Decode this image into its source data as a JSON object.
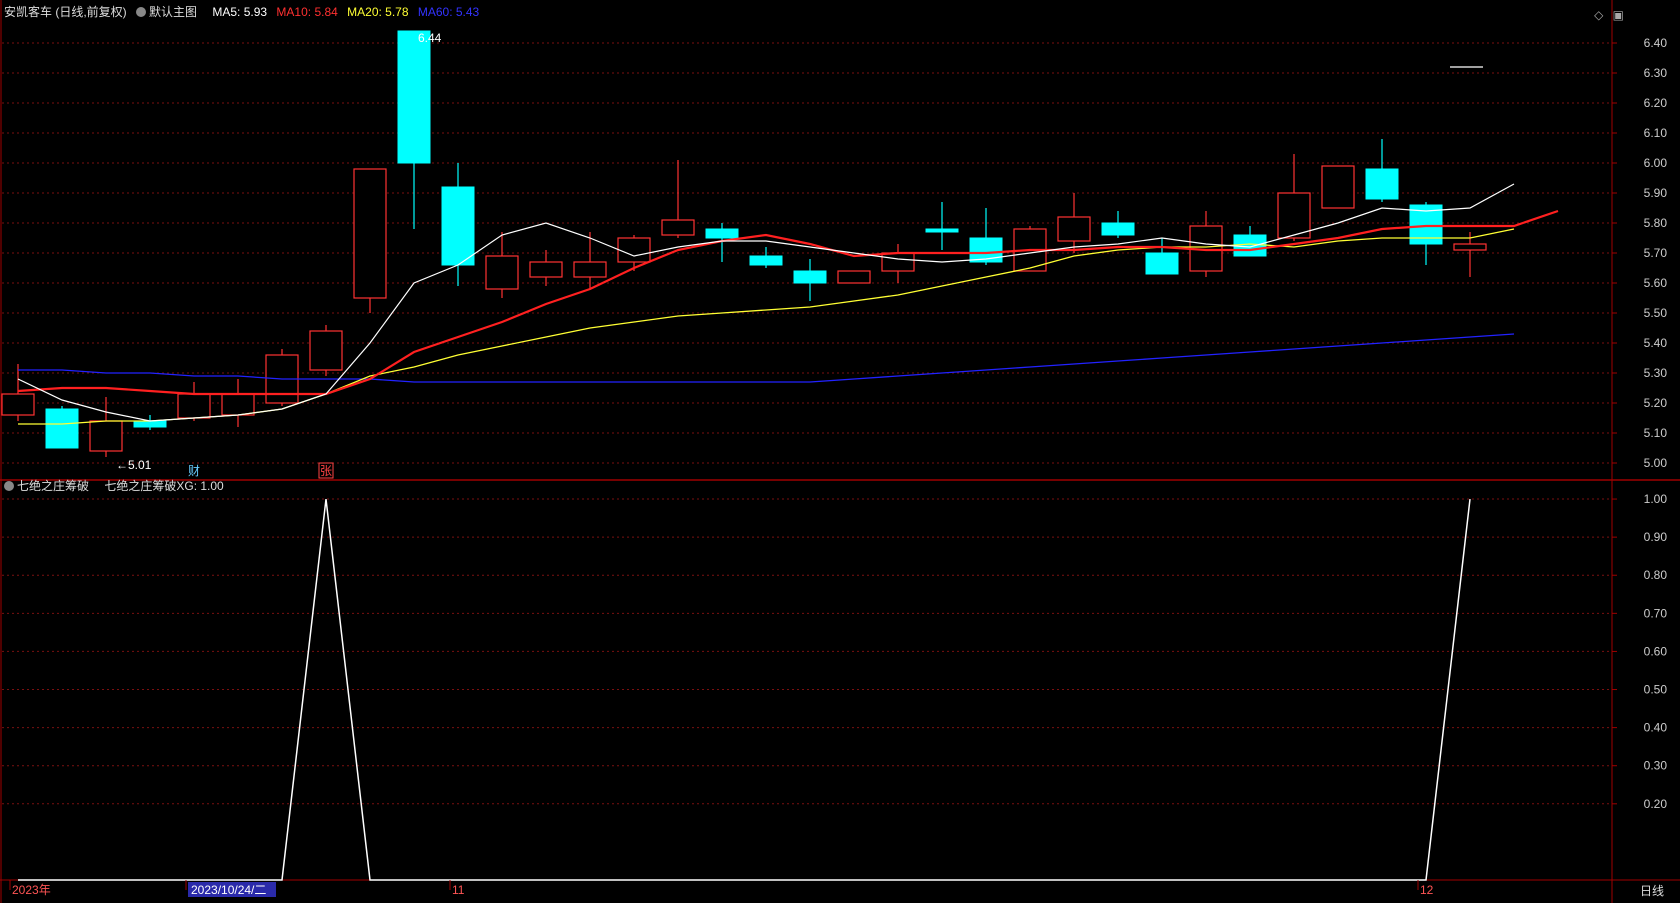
{
  "header": {
    "stock_name": "安凯客车 (日线,前复权)",
    "template": "默认主图",
    "ma5_label": "MA5: 5.93",
    "ma10_label": "MA10: 5.84",
    "ma20_label": "MA20: 5.78",
    "ma60_label": "MA60: 5.43"
  },
  "indicator_header": {
    "name": "七绝之庄筹破",
    "value_label": "七绝之庄筹破XG: 1.00"
  },
  "colors": {
    "up": "#ff3333",
    "down": "#00ffff",
    "ma5": "#ffffff",
    "ma10": "#ff2020",
    "ma20": "#ffff33",
    "ma60": "#2222ff",
    "frame": "#a00000",
    "grid": "#7a1010",
    "axis_text": "#cccccc",
    "date_highlight": "#2a2aaa"
  },
  "chart_data": [
    {
      "type": "candlestick",
      "title": "安凯客车 (日线,前复权)",
      "ylim": [
        4.95,
        6.47
      ],
      "yticks": [
        "6.40",
        "6.30",
        "6.20",
        "6.10",
        "6.00",
        "5.90",
        "5.80",
        "5.70",
        "5.60",
        "5.50",
        "5.40",
        "5.30",
        "5.20",
        "5.10",
        "5.00"
      ],
      "candles": [
        {
          "o": 5.16,
          "h": 5.33,
          "l": 5.14,
          "c": 5.23
        },
        {
          "o": 5.18,
          "h": 5.19,
          "l": 5.05,
          "c": 5.05
        },
        {
          "o": 5.04,
          "h": 5.22,
          "l": 5.02,
          "c": 5.14
        },
        {
          "o": 5.14,
          "h": 5.16,
          "l": 5.11,
          "c": 5.12
        },
        {
          "o": 5.15,
          "h": 5.27,
          "l": 5.14,
          "c": 5.23
        },
        {
          "o": 5.16,
          "h": 5.28,
          "l": 5.12,
          "c": 5.23
        },
        {
          "o": 5.2,
          "h": 5.38,
          "l": 5.19,
          "c": 5.36
        },
        {
          "o": 5.31,
          "h": 5.46,
          "l": 5.29,
          "c": 5.44
        },
        {
          "o": 5.55,
          "h": 5.98,
          "l": 5.5,
          "c": 5.98
        },
        {
          "o": 6.44,
          "h": 6.44,
          "l": 5.78,
          "c": 6.0
        },
        {
          "o": 5.92,
          "h": 6.0,
          "l": 5.59,
          "c": 5.66
        },
        {
          "o": 5.58,
          "h": 5.77,
          "l": 5.55,
          "c": 5.69
        },
        {
          "o": 5.62,
          "h": 5.71,
          "l": 5.59,
          "c": 5.67
        },
        {
          "o": 5.62,
          "h": 5.77,
          "l": 5.58,
          "c": 5.67
        },
        {
          "o": 5.67,
          "h": 5.76,
          "l": 5.64,
          "c": 5.75
        },
        {
          "o": 5.76,
          "h": 6.01,
          "l": 5.75,
          "c": 5.81
        },
        {
          "o": 5.78,
          "h": 5.8,
          "l": 5.67,
          "c": 5.75
        },
        {
          "o": 5.69,
          "h": 5.72,
          "l": 5.65,
          "c": 5.66
        },
        {
          "o": 5.64,
          "h": 5.68,
          "l": 5.54,
          "c": 5.6
        },
        {
          "o": 5.6,
          "h": 5.63,
          "l": 5.6,
          "c": 5.64
        },
        {
          "o": 5.64,
          "h": 5.73,
          "l": 5.6,
          "c": 5.7
        },
        {
          "o": 5.78,
          "h": 5.87,
          "l": 5.71,
          "c": 5.77
        },
        {
          "o": 5.75,
          "h": 5.85,
          "l": 5.66,
          "c": 5.67
        },
        {
          "o": 5.64,
          "h": 5.79,
          "l": 5.64,
          "c": 5.78
        },
        {
          "o": 5.74,
          "h": 5.9,
          "l": 5.7,
          "c": 5.82
        },
        {
          "o": 5.8,
          "h": 5.84,
          "l": 5.75,
          "c": 5.76
        },
        {
          "o": 5.7,
          "h": 5.75,
          "l": 5.63,
          "c": 5.63
        },
        {
          "o": 5.64,
          "h": 5.84,
          "l": 5.62,
          "c": 5.79
        },
        {
          "o": 5.76,
          "h": 5.79,
          "l": 5.69,
          "c": 5.69
        },
        {
          "o": 5.75,
          "h": 6.03,
          "l": 5.74,
          "c": 5.9
        },
        {
          "o": 5.85,
          "h": 5.99,
          "l": 5.85,
          "c": 5.99
        },
        {
          "o": 5.98,
          "h": 6.08,
          "l": 5.87,
          "c": 5.88
        },
        {
          "o": 5.86,
          "h": 5.87,
          "l": 5.66,
          "c": 5.73
        },
        {
          "o": 5.71,
          "h": 5.77,
          "l": 5.62,
          "c": 5.73
        }
      ],
      "ma5": [
        5.28,
        5.21,
        5.17,
        5.14,
        5.15,
        5.16,
        5.18,
        5.23,
        5.4,
        5.6,
        5.66,
        5.76,
        5.8,
        5.75,
        5.69,
        5.72,
        5.74,
        5.74,
        5.72,
        5.7,
        5.68,
        5.67,
        5.68,
        5.7,
        5.72,
        5.73,
        5.75,
        5.73,
        5.72,
        5.76,
        5.8,
        5.85,
        5.84,
        5.85,
        5.93
      ],
      "ma10": [
        5.24,
        5.25,
        5.25,
        5.24,
        5.23,
        5.23,
        5.23,
        5.23,
        5.28,
        5.37,
        5.42,
        5.47,
        5.53,
        5.58,
        5.65,
        5.71,
        5.74,
        5.76,
        5.73,
        5.69,
        5.7,
        5.7,
        5.7,
        5.71,
        5.71,
        5.72,
        5.72,
        5.71,
        5.71,
        5.73,
        5.75,
        5.78,
        5.79,
        5.79,
        5.79,
        5.84
      ],
      "ma20": [
        5.13,
        5.13,
        5.14,
        5.14,
        5.15,
        5.16,
        5.18,
        5.23,
        5.29,
        5.32,
        5.36,
        5.39,
        5.42,
        5.45,
        5.47,
        5.49,
        5.5,
        5.51,
        5.52,
        5.54,
        5.56,
        5.59,
        5.62,
        5.65,
        5.69,
        5.71,
        5.72,
        5.72,
        5.73,
        5.72,
        5.74,
        5.75,
        5.75,
        5.75,
        5.78
      ],
      "ma60": [
        5.31,
        5.31,
        5.3,
        5.3,
        5.29,
        5.29,
        5.28,
        5.28,
        5.28,
        5.27,
        5.27,
        5.27,
        5.27,
        5.27,
        5.27,
        5.27,
        5.27,
        5.27,
        5.27,
        5.28,
        5.29,
        5.3,
        5.31,
        5.32,
        5.33,
        5.34,
        5.35,
        5.36,
        5.37,
        5.38,
        5.39,
        5.4,
        5.41,
        5.42,
        5.43
      ],
      "annotations": [
        {
          "text": "6.44",
          "index": 9
        },
        {
          "text": "←5.01",
          "index": 2
        }
      ],
      "markers": [
        {
          "text": "财",
          "index": 4,
          "color": "#66ccff"
        },
        {
          "text": "张",
          "index": 7,
          "color": "#ff4444",
          "box": true
        }
      ]
    },
    {
      "type": "line",
      "title": "七绝之庄筹破",
      "series": [
        {
          "name": "七绝之庄筹破XG",
          "values": [
            0,
            0,
            0,
            0,
            0,
            0,
            0,
            1,
            0,
            0,
            0,
            0,
            0,
            0,
            0,
            0,
            0,
            0,
            0,
            0,
            0,
            0,
            0,
            0,
            0,
            0,
            0,
            0,
            0,
            0,
            0,
            0,
            0,
            1
          ]
        }
      ],
      "ylim": [
        0,
        1.05
      ],
      "yticks": [
        "1.00",
        "0.90",
        "0.80",
        "0.70",
        "0.60",
        "0.50",
        "0.40",
        "0.30",
        "0.20"
      ],
      "x_labels": [
        {
          "text": "2023年",
          "index": 0
        },
        {
          "text": "2023/10/24/二",
          "index": 4,
          "highlight": true
        },
        {
          "text": "11",
          "index": 10
        },
        {
          "text": "12",
          "index": 32
        }
      ]
    }
  ],
  "controls": {
    "period_label": "日线"
  }
}
